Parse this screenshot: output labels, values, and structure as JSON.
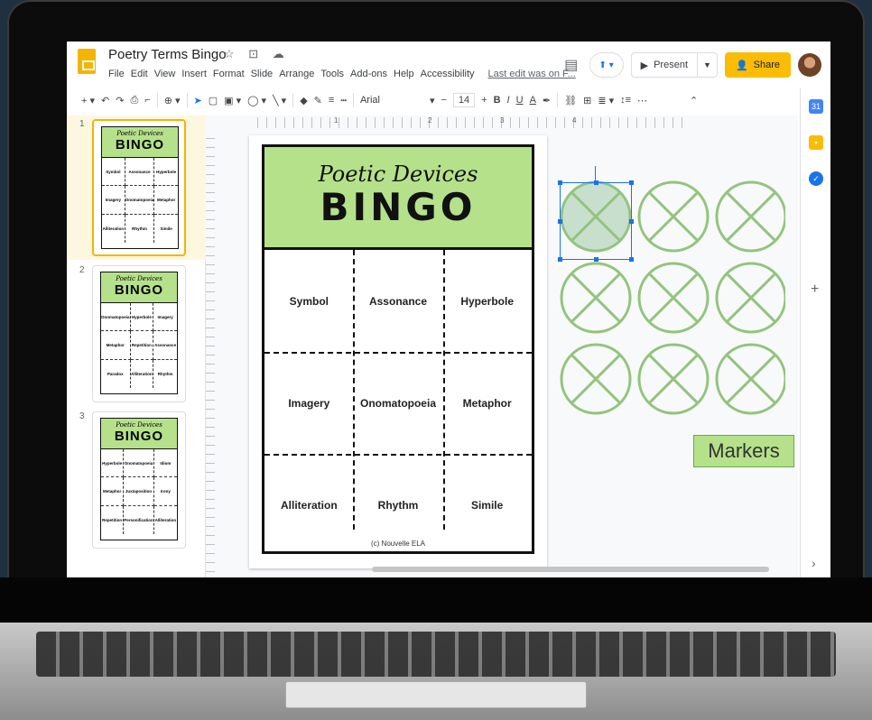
{
  "app": {
    "doc_title": "Poetry Terms Bingo",
    "title_icons": "☆ ⊡ ☁",
    "menu": [
      "File",
      "Edit",
      "View",
      "Insert",
      "Format",
      "Slide",
      "Arrange",
      "Tools",
      "Add-ons",
      "Help",
      "Accessibility"
    ],
    "last_edit": "Last edit was on F...",
    "present_label": "Present",
    "share_label": "Share"
  },
  "toolbar": {
    "font": "Arial",
    "font_size": "14",
    "bold": "B",
    "italic": "I",
    "underline": "U",
    "text_color": "A",
    "more": "⋯"
  },
  "ruler": {
    "marks": [
      "1",
      "2",
      "3",
      "4"
    ]
  },
  "filmstrip": {
    "slides": [
      {
        "num": "1",
        "sub": "Poetic Devices",
        "title": "BINGO",
        "cells": [
          "Symbol",
          "Assonance",
          "Hyperbole",
          "Imagery",
          "Onomatopoeia",
          "Metaphor",
          "Alliteration",
          "Rhythm",
          "Simile"
        ]
      },
      {
        "num": "2",
        "sub": "Poetic Devices",
        "title": "BINGO",
        "cells": [
          "Onomatopoeia",
          "Hyperbole",
          "Imagery",
          "Metaphor",
          "Repetition",
          "Assonance",
          "Paradox",
          "Alliteration",
          "Rhythm"
        ]
      },
      {
        "num": "3",
        "sub": "Poetic Devices",
        "title": "BINGO",
        "cells": [
          "Hyperbole",
          "Onomatopoeia",
          "Idiom",
          "Metaphor",
          "Juxtaposition",
          "Irony",
          "Repetition",
          "Personification",
          "Alliteration"
        ]
      }
    ]
  },
  "card": {
    "subtitle": "Poetic Devices",
    "title": "BINGO",
    "cells": [
      "Symbol",
      "Assonance",
      "Hyperbole",
      "Imagery",
      "Onomatopoeia",
      "Metaphor",
      "Alliteration",
      "Rhythm",
      "Simile"
    ],
    "copyright": "(c) Nouvelle ELA"
  },
  "markers": {
    "label": "Markers",
    "count": 9
  },
  "colors": {
    "header_green": "#b5e18b",
    "marker_green": "#93c47d",
    "share_yellow": "#fbbc04",
    "selection_blue": "#1a73e8"
  }
}
